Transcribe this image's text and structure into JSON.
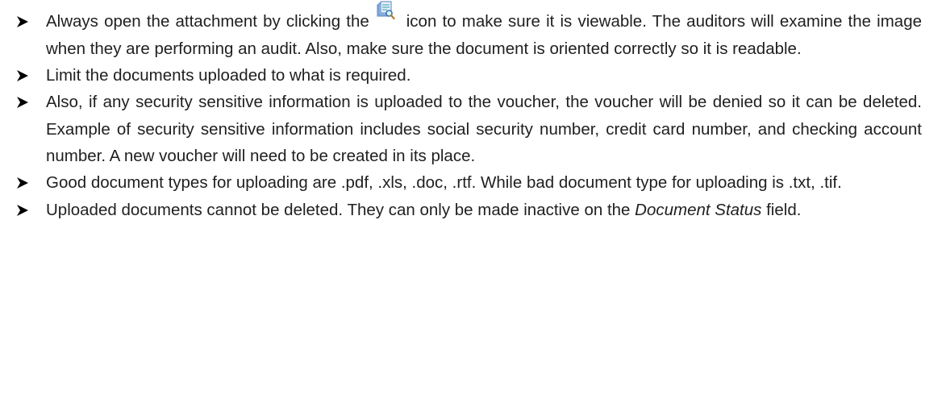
{
  "bullets": [
    {
      "before_icon": "Always open the attachment by clicking the",
      "icon": "view-attachment-icon",
      "after_icon": "icon to make sure it is viewable. The auditors will examine the image when they are performing an audit. Also, make sure the document is oriented correctly so it is readable."
    },
    {
      "text": "Limit the documents uploaded to what is required."
    },
    {
      "text": "Also, if any security sensitive information is uploaded to the voucher, the voucher will be denied so it can be deleted. Example of security sensitive information includes social security number, credit card number, and checking account number. A new voucher will need to be created in its place."
    },
    {
      "text": "Good document types for uploading are .pdf, .xls, .doc, .rtf. While bad document type for uploading is .txt, .tif."
    },
    {
      "text_before": "Uploaded documents cannot be deleted. They can only be made inactive on the",
      "emphasis": "Document Status",
      "text_after": "field."
    }
  ],
  "marker_icon": "arrowhead-bullet-icon",
  "colors": {
    "text": "#1f1f1f",
    "marker": "#000000",
    "icon_blue": "#5b8fd6",
    "icon_teal": "#2f9ca3"
  }
}
